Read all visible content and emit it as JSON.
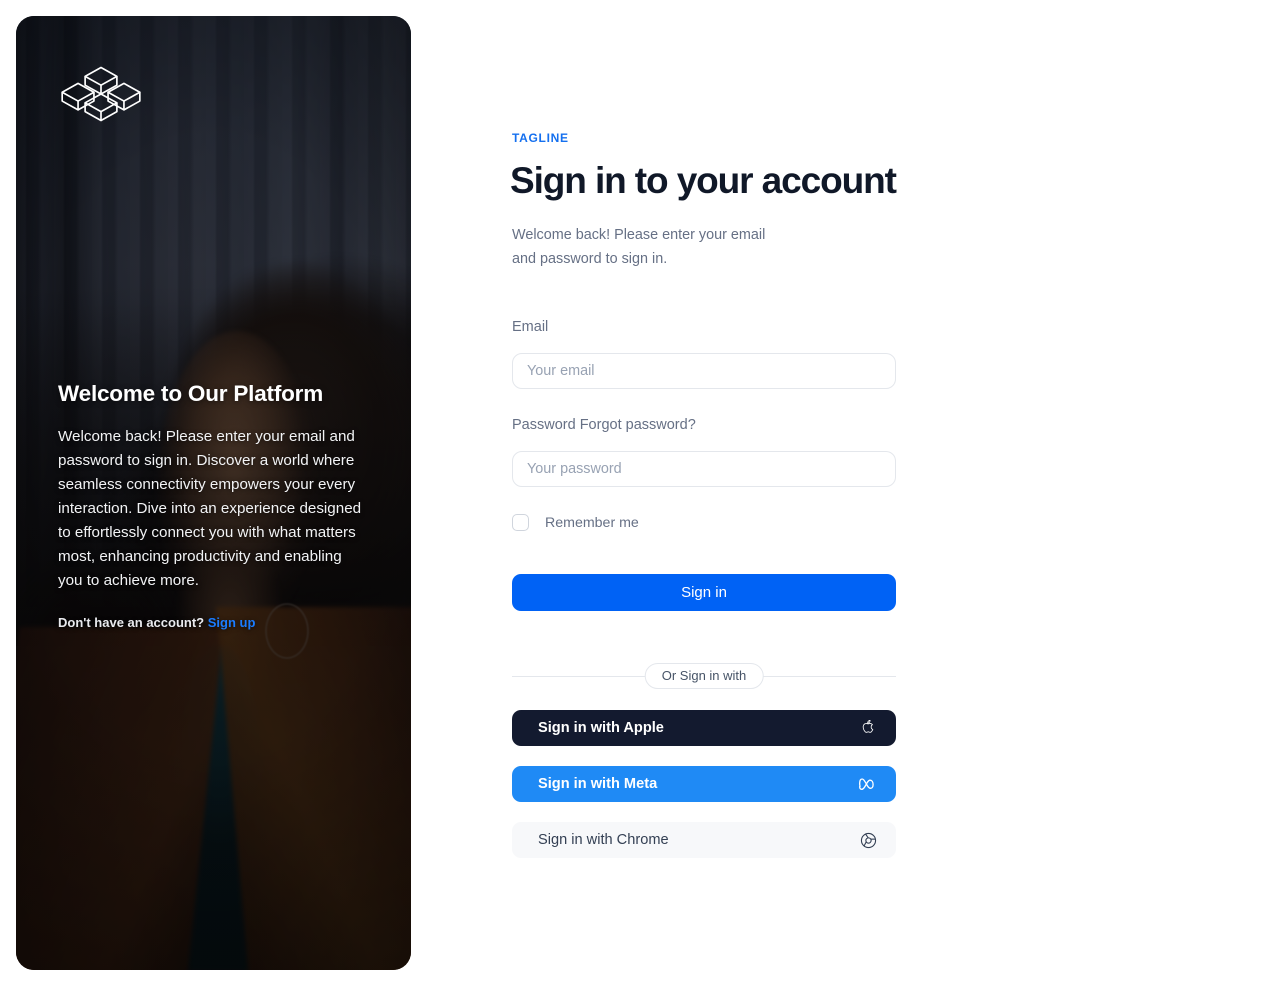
{
  "hero": {
    "logo_icon": "cubes-cluster-logo-icon",
    "title": "Welcome to Our Platform",
    "body": "Welcome back! Please enter your email and password to sign in. Discover a world where seamless connectivity empowers your every interaction. Dive into an experience designed to effortlessly connect you with what matters most, enhancing productivity and enabling you to achieve more.",
    "footer_text": "Don't have an account?",
    "signup_link": "Sign up",
    "background_description": "Portrait of a woman in a rust blazer and teal top against dark blinds"
  },
  "form": {
    "tagline": "TAGLINE",
    "title": "Sign in to your account",
    "subtitle": "Welcome back! Please enter your email and password to sign in.",
    "email_label": "Email",
    "email_placeholder": "Your email",
    "email_value": "",
    "password_label": "Password",
    "forgot_label": "Forgot password?",
    "password_placeholder": "Your password",
    "password_value": "",
    "remember_label": "Remember me",
    "remember_checked": false,
    "submit_label": "Sign in",
    "divider_label": "Or Sign in with",
    "social": [
      {
        "label": "Sign in with Apple",
        "icon": "apple-icon",
        "bg": "#131a2f",
        "fg": "#ffffff"
      },
      {
        "label": "Sign in with Meta",
        "icon": "meta-icon",
        "bg": "#1f8af5",
        "fg": "#ffffff"
      },
      {
        "label": "Sign in with Chrome",
        "icon": "chrome-icon",
        "bg": "#f7f8fa",
        "fg": "#344054"
      }
    ]
  },
  "colors": {
    "accent_blue": "#0062f5",
    "tagline_blue": "#1570ef",
    "link_blue": "#1a7cff",
    "heading": "#101828",
    "muted": "#667085",
    "border": "#e4e7ec"
  }
}
